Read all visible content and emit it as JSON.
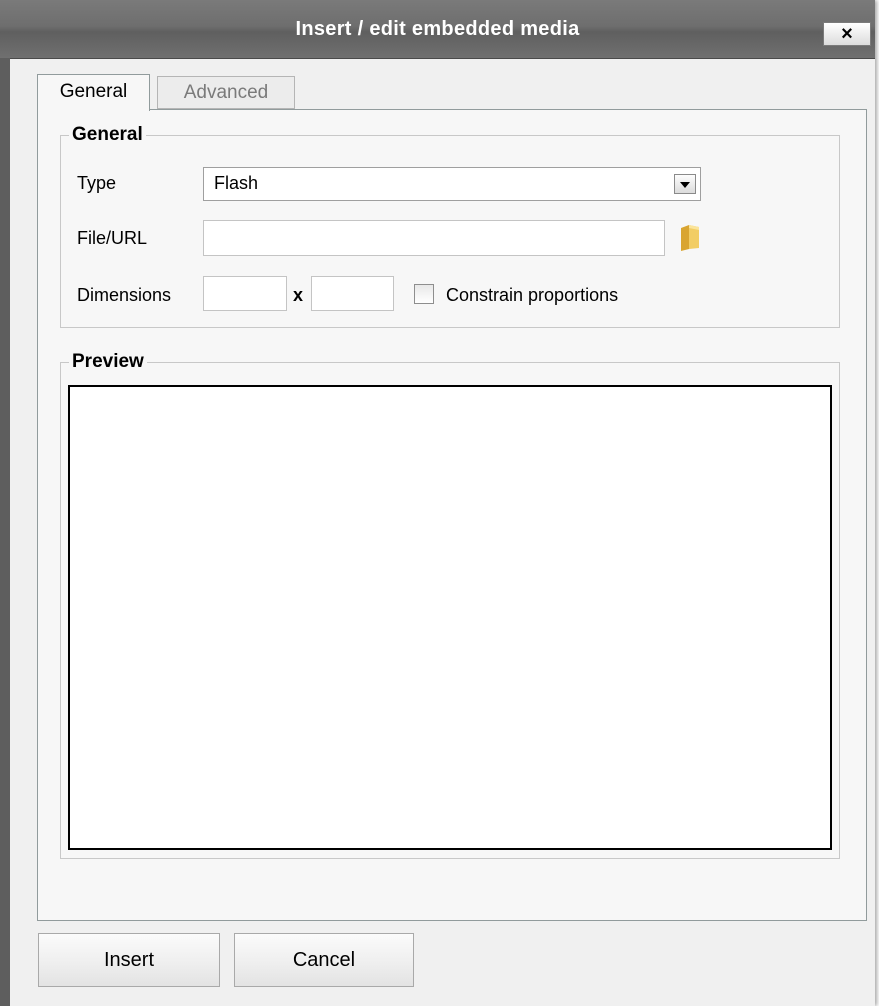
{
  "window": {
    "title": "Insert / edit embedded media",
    "close_label": "×"
  },
  "tabs": [
    {
      "label": "General",
      "active": true
    },
    {
      "label": "Advanced",
      "active": false
    }
  ],
  "general": {
    "legend": "General",
    "type_label": "Type",
    "type_value": "Flash",
    "file_label": "File/URL",
    "file_value": "",
    "dimensions_label": "Dimensions",
    "width_value": "",
    "height_value": "",
    "x_separator": "x",
    "constrain_label": "Constrain proportions",
    "constrain_checked": false
  },
  "preview": {
    "legend": "Preview"
  },
  "buttons": {
    "insert": "Insert",
    "cancel": "Cancel"
  },
  "icons": {
    "browse": "folder-icon",
    "dropdown": "chevron-down-icon",
    "close": "close-icon"
  }
}
